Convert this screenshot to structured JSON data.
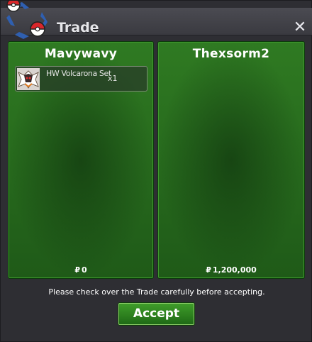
{
  "window": {
    "title": "Trade",
    "close_icon": "close-icon",
    "logo_icon": "pokeball-logo-icon"
  },
  "left_panel": {
    "trader_name": "Mavywavy",
    "items": [
      {
        "icon": "volcarona-item-icon",
        "name": "HW Volcarona Set",
        "quantity": "x1"
      }
    ],
    "money_symbol": "₽",
    "money": "0"
  },
  "right_panel": {
    "trader_name": "Thexsorm2",
    "items": [],
    "money_symbol": "₽",
    "money": "1,200,000"
  },
  "footer": {
    "notice": "Please check over the Trade carefully before accepting.",
    "accept_label": "Accept"
  },
  "colors": {
    "panel_green": "#2f7a22",
    "window_bg": "#2e2e33",
    "accept_green": "#3f9c2a"
  }
}
